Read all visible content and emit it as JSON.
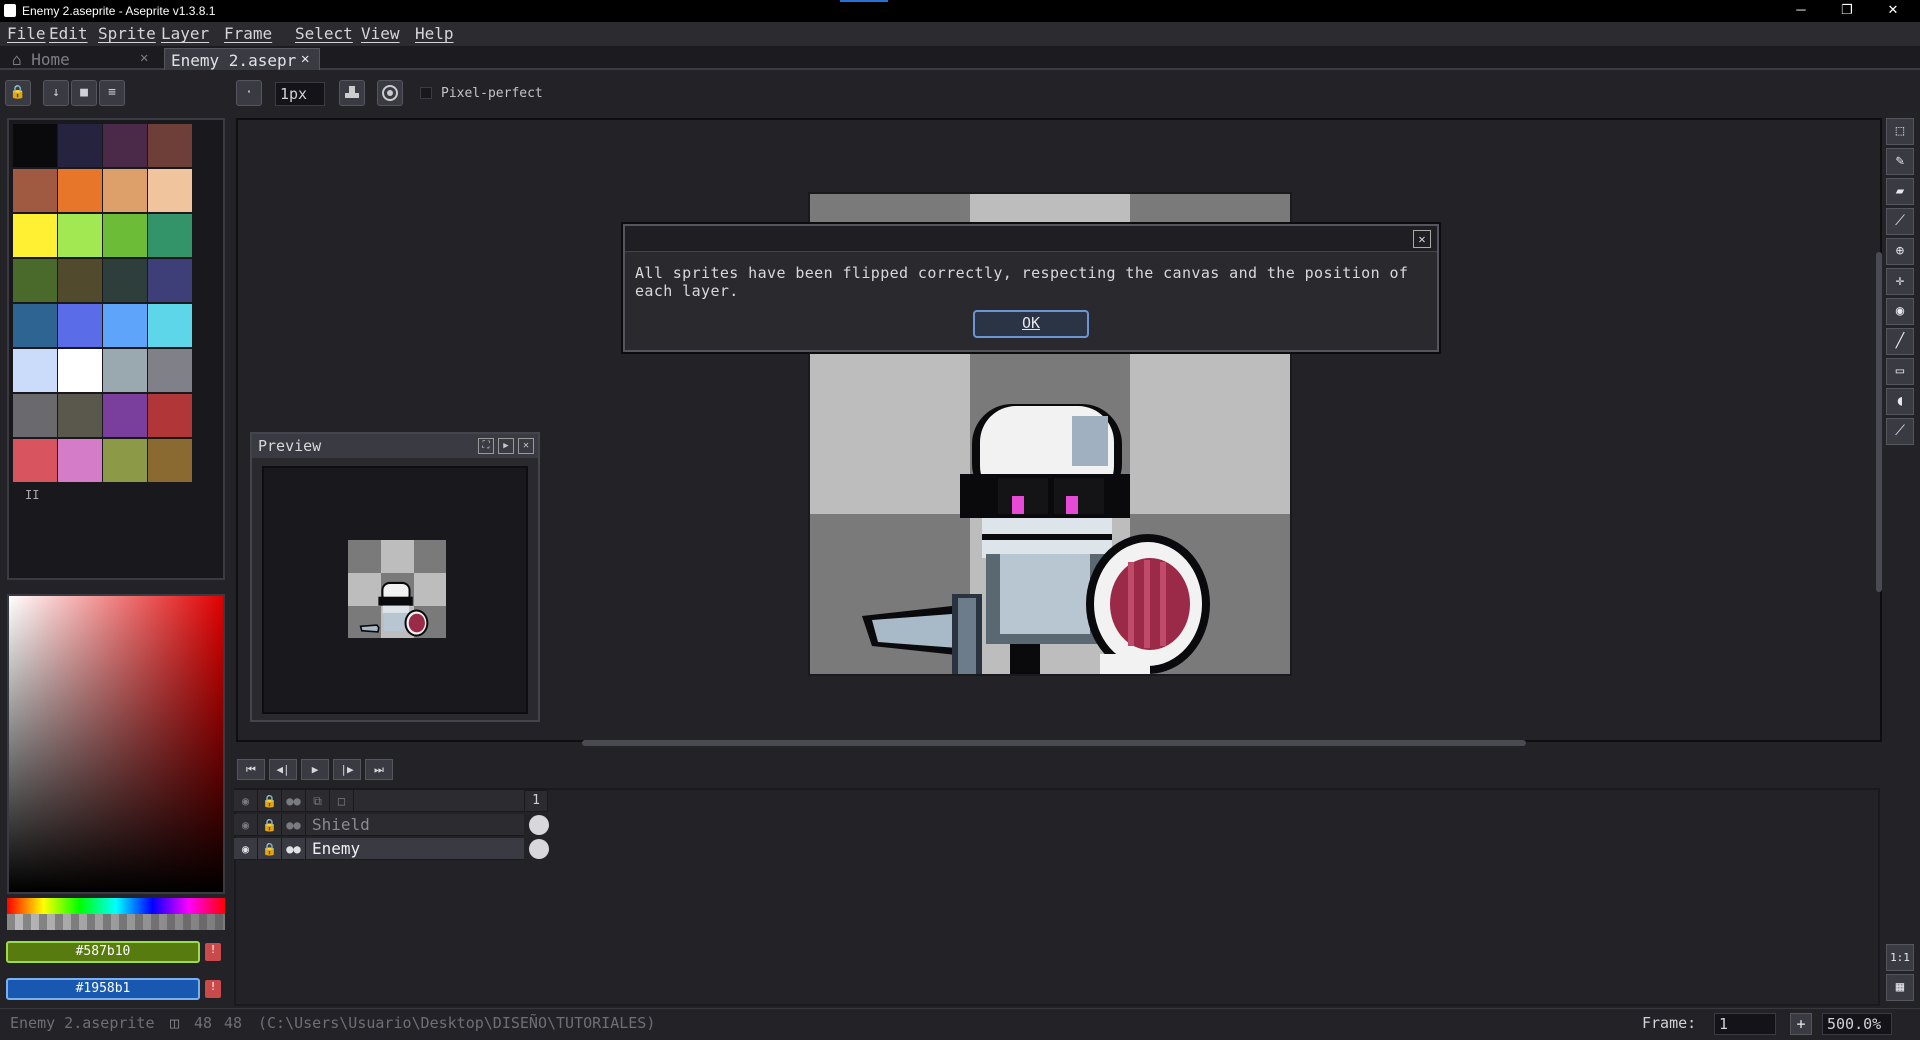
{
  "window": {
    "title": "Enemy 2.aseprite - Aseprite v1.3.8.1",
    "minimize": "─",
    "maximize": "❐",
    "close": "✕"
  },
  "menu": [
    "File",
    "Edit",
    "Sprite",
    "Layer",
    "Frame",
    "Select",
    "View",
    "Help"
  ],
  "tabs": [
    {
      "label": "Home",
      "active": false,
      "close": "✕",
      "icon": "home-icon"
    },
    {
      "label": "Enemy 2.asepr",
      "active": true,
      "close": "✕"
    }
  ],
  "palette_toolbar": {
    "lock": "🔒",
    "down": "↓",
    "save": "■",
    "menu": "≡"
  },
  "brush_toolbar": {
    "brush_shape": "·",
    "brush_size": "1px",
    "ink_icon": "stamp-icon",
    "symmetry_icon": "target-icon",
    "pixel_perfect_label": "Pixel-perfect",
    "pixel_perfect_checked": false
  },
  "palette": {
    "colors": [
      "#0a0a0c",
      "#26233e",
      "#4a2a48",
      "#6e3e38",
      "#a05a42",
      "#e7762a",
      "#dea06a",
      "#f0c49c",
      "#fff034",
      "#a2e852",
      "#6cbc38",
      "#329468",
      "#4a6a2c",
      "#524a2c",
      "#2e3e3a",
      "#3e3e78",
      "#2e6492",
      "#5a6ce8",
      "#5ea4fa",
      "#5cd6e8",
      "#cadcfa",
      "#ffffff",
      "#9aa8b0",
      "#808088",
      "#6a6a6e",
      "#5a584c",
      "#7a3e9c",
      "#b03638",
      "#d8545e",
      "#d47cc8",
      "#8c9a48",
      "#8a6a30"
    ],
    "page_indicator": "II"
  },
  "color_bar": {
    "foreground_hex": "#587b10",
    "foreground_label": "#587b10",
    "background_hex": "#1958b1",
    "background_label": "#1958b1",
    "warn_icon": "!"
  },
  "preview": {
    "title": "Preview",
    "buttons": {
      "expand": "⛶",
      "play": "▶",
      "close": "✕"
    }
  },
  "dialog": {
    "message": "All sprites have been flipped correctly, respecting the canvas and the position of each layer.",
    "ok_label": "OK",
    "close": "✕"
  },
  "tools": [
    "selection-icon",
    "pencil-icon",
    "eraser-icon",
    "eyedropper-icon",
    "zoom-icon",
    "move-icon",
    "fill-icon",
    "line-icon",
    "rectangle-icon",
    "blur-icon",
    "smudge-icon"
  ],
  "tool_glyphs": [
    "⬚",
    "✎",
    "▰",
    "⟋",
    "⊕",
    "✛",
    "◉",
    "╱",
    "▭",
    "◖",
    "⟋"
  ],
  "timeline": {
    "buttons": [
      "⏮",
      "◀|",
      "▶",
      "|▶",
      "⏭"
    ],
    "frame_header": "1",
    "layers": [
      {
        "name": "Shield",
        "visible_icon": "eye-icon",
        "highlight": false
      },
      {
        "name": "Enemy",
        "visible_icon": "eye-icon",
        "highlight": true
      }
    ]
  },
  "side_buttons": {
    "one_to_one": "1:1",
    "grid": "▦"
  },
  "status": {
    "filename": "Enemy 2.aseprite",
    "size_icon": "sprite-size-icon",
    "width": "48",
    "height": "48",
    "path": "(C:\\Users\\Usuario\\Desktop\\DISEÑO\\TUTORIALES)",
    "frame_label": "Frame:",
    "frame_value": "1",
    "add_frame": "+",
    "zoom": "500.0%"
  }
}
